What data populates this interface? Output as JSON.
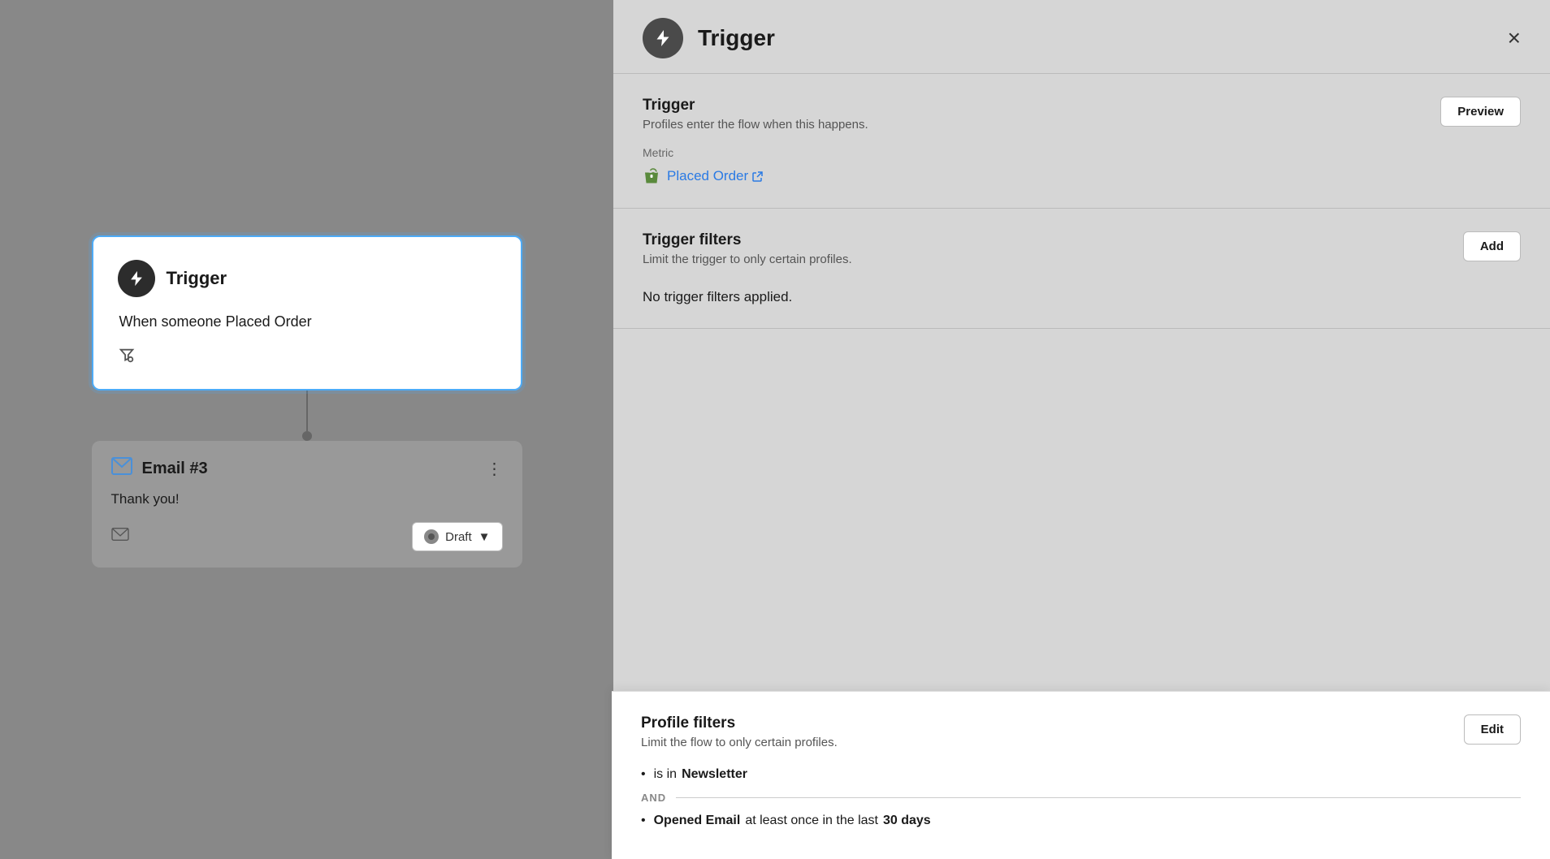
{
  "canvas": {
    "trigger_card": {
      "icon_label": "trigger-icon",
      "title": "Trigger",
      "body": "When someone Placed Order",
      "filter_icon_label": "filter-person-icon"
    },
    "email_card": {
      "icon_label": "email-icon",
      "title": "Email #3",
      "body": "Thank you!",
      "draft_label": "Draft",
      "menu_icon_label": "more-options-icon"
    }
  },
  "panel": {
    "title": "Trigger",
    "close_label": "×",
    "trigger_section": {
      "title": "Trigger",
      "subtitle": "Profiles enter the flow when this happens.",
      "preview_label": "Preview",
      "metric_label": "Metric",
      "metric_link_text": "Placed Order",
      "metric_icon_label": "shopify-icon"
    },
    "trigger_filters_section": {
      "title": "Trigger filters",
      "subtitle": "Limit the trigger to only certain profiles.",
      "add_label": "Add",
      "no_filters_text": "No trigger filters applied."
    },
    "profile_filters_section": {
      "title": "Profile filters",
      "subtitle": "Limit the flow to only certain profiles.",
      "edit_label": "Edit",
      "filter1_prefix": "is in ",
      "filter1_bold": "Newsletter",
      "and_label": "AND",
      "filter2_prefix": "Opened Email",
      "filter2_middle": " at least once in the last ",
      "filter2_bold": "30 days"
    }
  },
  "colors": {
    "accent_blue": "#4dabf7",
    "link_blue": "#2a7ae4",
    "shopify_green": "#5a8a3c",
    "dark_circle": "#2c2c2c",
    "panel_bg": "#d6d6d6"
  }
}
